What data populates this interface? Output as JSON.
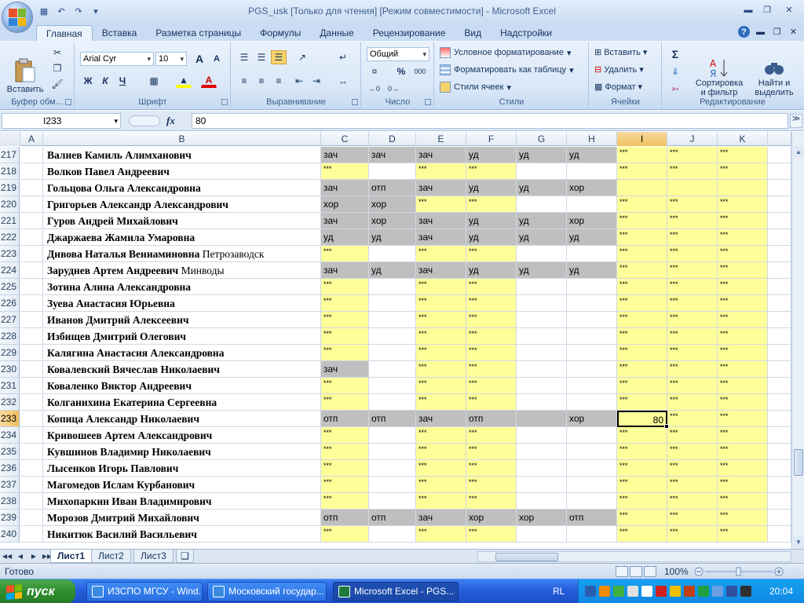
{
  "window": {
    "title": "PGS_usk  [Только для чтения]  [Режим совместимости] - Microsoft Excel"
  },
  "ribbon_tabs": [
    "Главная",
    "Вставка",
    "Разметка страницы",
    "Формулы",
    "Данные",
    "Рецензирование",
    "Вид",
    "Надстройки"
  ],
  "ribbon": {
    "clipboard": {
      "label": "Буфер обм...",
      "paste": "Вставить"
    },
    "font": {
      "label": "Шрифт",
      "name": "Arial Cyr",
      "size": "10",
      "bold": "Ж",
      "italic": "К",
      "underline": "Ч",
      "grow": "A",
      "shrink": "A"
    },
    "alignment": {
      "label": "Выравнивание"
    },
    "number": {
      "label": "Число",
      "format": "Общий",
      "percent": "%",
      "thousands": "000"
    },
    "styles": {
      "label": "Стили",
      "conditional": "Условное форматирование",
      "as_table": "Форматировать как таблицу",
      "cell_styles": "Стили ячеек"
    },
    "cells": {
      "label": "Ячейки",
      "insert": "Вставить",
      "delete": "Удалить",
      "format": "Формат"
    },
    "editing": {
      "label": "Редактирование",
      "sigma": "Σ",
      "sort": "Сортировка и фильтр",
      "find": "Найти и выделить"
    }
  },
  "formula_bar": {
    "cell_ref": "I233",
    "fx": "fx",
    "value": "80"
  },
  "columns": [
    "A",
    "B",
    "C",
    "D",
    "E",
    "F",
    "G",
    "H",
    "I",
    "J",
    "K"
  ],
  "rows": [
    {
      "num": "217",
      "name": "Валиев Камиль Алимханович",
      "city": "",
      "cells": [
        [
          "зач",
          "g"
        ],
        [
          "зач",
          "g"
        ],
        [
          "зач",
          "g"
        ],
        [
          "уд",
          "g"
        ],
        [
          "уд",
          "g"
        ],
        [
          "уд",
          "g"
        ],
        [
          "***",
          "y"
        ],
        [
          "***",
          "y"
        ],
        [
          "***",
          "y"
        ]
      ]
    },
    {
      "num": "218",
      "name": "Волков Павел Андреевич",
      "city": "",
      "cells": [
        [
          "***",
          "y"
        ],
        [
          "",
          "w"
        ],
        [
          "***",
          "y"
        ],
        [
          "***",
          "y"
        ],
        [
          "",
          "w"
        ],
        [
          "",
          "w"
        ],
        [
          "***",
          "y"
        ],
        [
          "***",
          "y"
        ],
        [
          "***",
          "y"
        ]
      ]
    },
    {
      "num": "219",
      "name": "Гольцова Ольга Александровна",
      "city": "",
      "cells": [
        [
          "зач",
          "g"
        ],
        [
          "отп",
          "g"
        ],
        [
          "зач",
          "g"
        ],
        [
          "уд",
          "g"
        ],
        [
          "уд",
          "g"
        ],
        [
          "хор",
          "g"
        ],
        [
          "",
          "y"
        ],
        [
          "",
          "y"
        ],
        [
          "",
          "y"
        ]
      ]
    },
    {
      "num": "220",
      "name": "Григорьев Александр Александрович",
      "city": "",
      "cells": [
        [
          "хор",
          "g"
        ],
        [
          "хор",
          "g"
        ],
        [
          "***",
          "y"
        ],
        [
          "***",
          "y"
        ],
        [
          "",
          "w"
        ],
        [
          "",
          "w"
        ],
        [
          "***",
          "y"
        ],
        [
          "***",
          "y"
        ],
        [
          "***",
          "y"
        ]
      ]
    },
    {
      "num": "221",
      "name": "Гуров Андрей Михайлович",
      "city": "",
      "cells": [
        [
          "зач",
          "g"
        ],
        [
          "хор",
          "g"
        ],
        [
          "зач",
          "g"
        ],
        [
          "уд",
          "g"
        ],
        [
          "уд",
          "g"
        ],
        [
          "хор",
          "g"
        ],
        [
          "***",
          "y"
        ],
        [
          "***",
          "y"
        ],
        [
          "***",
          "y"
        ]
      ]
    },
    {
      "num": "222",
      "name": "Джаржаева Жамила Умаровна",
      "city": "",
      "cells": [
        [
          "уд",
          "g"
        ],
        [
          "уд",
          "g"
        ],
        [
          "зач",
          "g"
        ],
        [
          "уд",
          "g"
        ],
        [
          "уд",
          "g"
        ],
        [
          "уд",
          "g"
        ],
        [
          "***",
          "y"
        ],
        [
          "***",
          "y"
        ],
        [
          "***",
          "y"
        ]
      ]
    },
    {
      "num": "223",
      "name": "Дивова Наталья Вениаминовна",
      "city": "Петрозаводск",
      "cells": [
        [
          "***",
          "y"
        ],
        [
          "",
          "w"
        ],
        [
          "***",
          "y"
        ],
        [
          "***",
          "y"
        ],
        [
          "",
          "w"
        ],
        [
          "",
          "w"
        ],
        [
          "***",
          "y"
        ],
        [
          "***",
          "y"
        ],
        [
          "***",
          "y"
        ]
      ]
    },
    {
      "num": "224",
      "name": "Заруднев Артем Андреевич",
      "city": "Минводы",
      "cells": [
        [
          "зач",
          "g"
        ],
        [
          "уд",
          "g"
        ],
        [
          "зач",
          "g"
        ],
        [
          "уд",
          "g"
        ],
        [
          "уд",
          "g"
        ],
        [
          "уд",
          "g"
        ],
        [
          "***",
          "y"
        ],
        [
          "***",
          "y"
        ],
        [
          "***",
          "y"
        ]
      ]
    },
    {
      "num": "225",
      "name": "Зотина Алина Александровна",
      "city": "",
      "cells": [
        [
          "***",
          "y"
        ],
        [
          "",
          "w"
        ],
        [
          "***",
          "y"
        ],
        [
          "***",
          "y"
        ],
        [
          "",
          "w"
        ],
        [
          "",
          "w"
        ],
        [
          "***",
          "y"
        ],
        [
          "***",
          "y"
        ],
        [
          "***",
          "y"
        ]
      ]
    },
    {
      "num": "226",
      "name": "Зуева Анастасия Юрьевна",
      "city": "",
      "cells": [
        [
          "***",
          "y"
        ],
        [
          "",
          "w"
        ],
        [
          "***",
          "y"
        ],
        [
          "***",
          "y"
        ],
        [
          "",
          "w"
        ],
        [
          "",
          "w"
        ],
        [
          "***",
          "y"
        ],
        [
          "***",
          "y"
        ],
        [
          "***",
          "y"
        ]
      ]
    },
    {
      "num": "227",
      "name": "Иванов Дмитрий Алексеевич",
      "city": "",
      "cells": [
        [
          "***",
          "y"
        ],
        [
          "",
          "w"
        ],
        [
          "***",
          "y"
        ],
        [
          "***",
          "y"
        ],
        [
          "",
          "w"
        ],
        [
          "",
          "w"
        ],
        [
          "***",
          "y"
        ],
        [
          "***",
          "y"
        ],
        [
          "***",
          "y"
        ]
      ]
    },
    {
      "num": "228",
      "name": "Избищев Дмитрий Олегович",
      "city": "",
      "cells": [
        [
          "***",
          "y"
        ],
        [
          "",
          "w"
        ],
        [
          "***",
          "y"
        ],
        [
          "***",
          "y"
        ],
        [
          "",
          "w"
        ],
        [
          "",
          "w"
        ],
        [
          "***",
          "y"
        ],
        [
          "***",
          "y"
        ],
        [
          "***",
          "y"
        ]
      ]
    },
    {
      "num": "229",
      "name": "Калягина Анастасия Александровна",
      "city": "",
      "cells": [
        [
          "***",
          "y"
        ],
        [
          "",
          "w"
        ],
        [
          "***",
          "y"
        ],
        [
          "***",
          "y"
        ],
        [
          "",
          "w"
        ],
        [
          "",
          "w"
        ],
        [
          "***",
          "y"
        ],
        [
          "***",
          "y"
        ],
        [
          "***",
          "y"
        ]
      ]
    },
    {
      "num": "230",
      "name": "Ковалевский Вячеслав Николаевич",
      "city": "",
      "cells": [
        [
          "зач",
          "g"
        ],
        [
          "",
          "w"
        ],
        [
          "***",
          "y"
        ],
        [
          "***",
          "y"
        ],
        [
          "",
          "w"
        ],
        [
          "",
          "w"
        ],
        [
          "***",
          "y"
        ],
        [
          "***",
          "y"
        ],
        [
          "***",
          "y"
        ]
      ]
    },
    {
      "num": "231",
      "name": "Коваленко Виктор Андреевич",
      "city": "",
      "cells": [
        [
          "***",
          "y"
        ],
        [
          "",
          "w"
        ],
        [
          "***",
          "y"
        ],
        [
          "***",
          "y"
        ],
        [
          "",
          "w"
        ],
        [
          "",
          "w"
        ],
        [
          "***",
          "y"
        ],
        [
          "***",
          "y"
        ],
        [
          "***",
          "y"
        ]
      ]
    },
    {
      "num": "232",
      "name": "Колганихина Екатерина Сергеевна",
      "city": "",
      "cells": [
        [
          "***",
          "y"
        ],
        [
          "",
          "w"
        ],
        [
          "***",
          "y"
        ],
        [
          "***",
          "y"
        ],
        [
          "",
          "w"
        ],
        [
          "",
          "w"
        ],
        [
          "***",
          "y"
        ],
        [
          "***",
          "y"
        ],
        [
          "***",
          "y"
        ]
      ]
    },
    {
      "num": "233",
      "name": "Копица Александр Николаевич",
      "city": "",
      "cells": [
        [
          "отп",
          "g"
        ],
        [
          "отп",
          "g"
        ],
        [
          "зач",
          "g"
        ],
        [
          "отп",
          "g"
        ],
        [
          "",
          "g"
        ],
        [
          "хор",
          "g"
        ],
        [
          "80",
          "y"
        ],
        [
          "***",
          "y"
        ],
        [
          "***",
          "y"
        ]
      ]
    },
    {
      "num": "234",
      "name": "Кривошеев Артем Александрович",
      "city": "",
      "cells": [
        [
          "***",
          "y"
        ],
        [
          "",
          "w"
        ],
        [
          "***",
          "y"
        ],
        [
          "***",
          "y"
        ],
        [
          "",
          "w"
        ],
        [
          "",
          "w"
        ],
        [
          "***",
          "y"
        ],
        [
          "***",
          "y"
        ],
        [
          "***",
          "y"
        ]
      ]
    },
    {
      "num": "235",
      "name": "Кувшинов Владимир Николаевич",
      "city": "",
      "cells": [
        [
          "***",
          "y"
        ],
        [
          "",
          "w"
        ],
        [
          "***",
          "y"
        ],
        [
          "***",
          "y"
        ],
        [
          "",
          "w"
        ],
        [
          "",
          "w"
        ],
        [
          "***",
          "y"
        ],
        [
          "***",
          "y"
        ],
        [
          "***",
          "y"
        ]
      ]
    },
    {
      "num": "236",
      "name": "Лысенков Игорь Павлович",
      "city": "",
      "cells": [
        [
          "***",
          "y"
        ],
        [
          "",
          "w"
        ],
        [
          "***",
          "y"
        ],
        [
          "***",
          "y"
        ],
        [
          "",
          "w"
        ],
        [
          "",
          "w"
        ],
        [
          "***",
          "y"
        ],
        [
          "***",
          "y"
        ],
        [
          "***",
          "y"
        ]
      ]
    },
    {
      "num": "237",
      "name": "Магомедов Ислам Курбанович",
      "city": "",
      "cells": [
        [
          "***",
          "y"
        ],
        [
          "",
          "w"
        ],
        [
          "***",
          "y"
        ],
        [
          "***",
          "y"
        ],
        [
          "",
          "w"
        ],
        [
          "",
          "w"
        ],
        [
          "***",
          "y"
        ],
        [
          "***",
          "y"
        ],
        [
          "***",
          "y"
        ]
      ]
    },
    {
      "num": "238",
      "name": "Михопаркин Иван Владимирович",
      "city": "",
      "cells": [
        [
          "***",
          "y"
        ],
        [
          "",
          "w"
        ],
        [
          "***",
          "y"
        ],
        [
          "***",
          "y"
        ],
        [
          "",
          "w"
        ],
        [
          "",
          "w"
        ],
        [
          "***",
          "y"
        ],
        [
          "***",
          "y"
        ],
        [
          "***",
          "y"
        ]
      ]
    },
    {
      "num": "239",
      "name": "Морозов Дмитрий Михайлович",
      "city": "",
      "cells": [
        [
          "отп",
          "g"
        ],
        [
          "отп",
          "g"
        ],
        [
          "зач",
          "g"
        ],
        [
          "хор",
          "g"
        ],
        [
          "хор",
          "g"
        ],
        [
          "отп",
          "g"
        ],
        [
          "***",
          "y"
        ],
        [
          "***",
          "y"
        ],
        [
          "***",
          "y"
        ]
      ]
    },
    {
      "num": "240",
      "name": "Никитюк Василий Васильевич",
      "city": "",
      "cells": [
        [
          "***",
          "y"
        ],
        [
          "",
          "w"
        ],
        [
          "***",
          "y"
        ],
        [
          "***",
          "y"
        ],
        [
          "",
          "w"
        ],
        [
          "",
          "w"
        ],
        [
          "***",
          "y"
        ],
        [
          "***",
          "y"
        ],
        [
          "***",
          "y"
        ]
      ]
    }
  ],
  "sheets": [
    "Лист1",
    "Лист2",
    "Лист3"
  ],
  "status": {
    "text": "Готово",
    "zoom": "100%"
  },
  "taskbar": {
    "start": "пуск",
    "tasks": [
      "ИЗСПО МГСУ - Wind...",
      "Московский государ...",
      "Microsoft Excel - PGS..."
    ],
    "lang": "RL",
    "clock": "20:04"
  },
  "colors": {
    "yellow": "#ffff99",
    "gray": "#bfbfbf",
    "selection": "#f1c15f"
  }
}
